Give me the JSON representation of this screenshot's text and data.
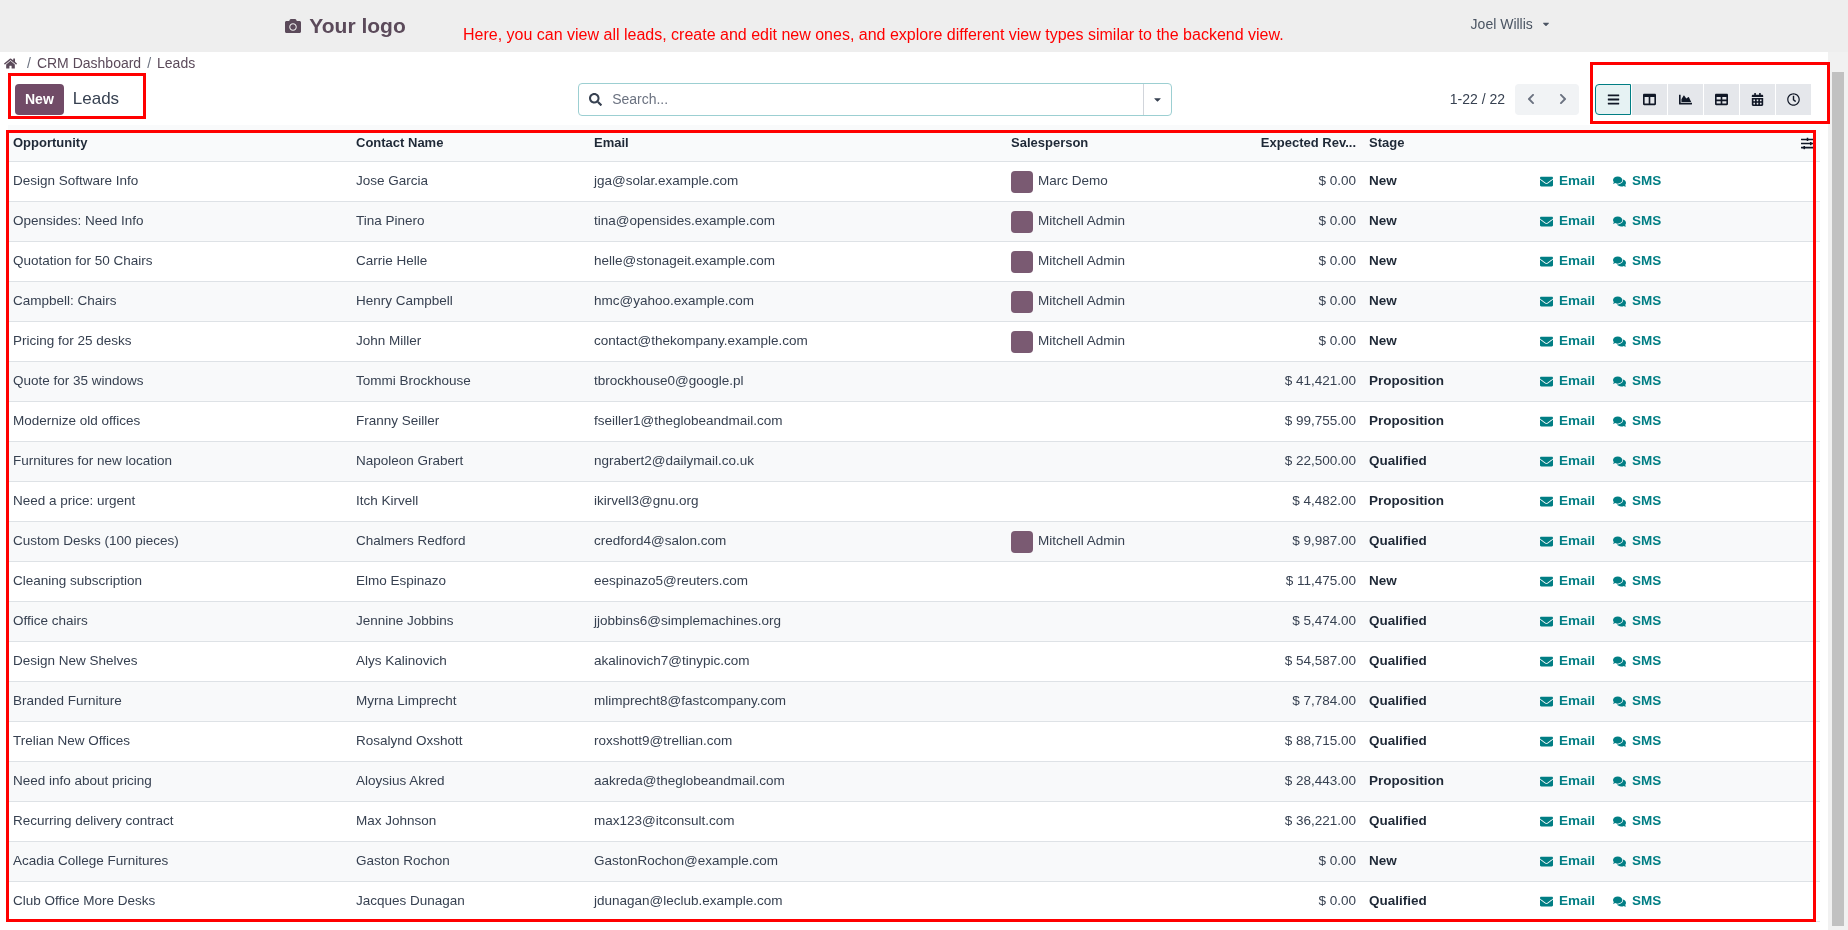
{
  "header": {
    "logo": "Your logo",
    "note": "Here, you can view all leads, create and edit new ones, and explore different view types similar to the backend view.",
    "user": "Joel Willis"
  },
  "breadcrumb": [
    {
      "kind": "separator",
      "text": "/"
    },
    {
      "kind": "link",
      "text": "CRM Dashboard"
    },
    {
      "kind": "separator",
      "text": "/"
    },
    {
      "kind": "link",
      "text": "Leads"
    }
  ],
  "control_panel": {
    "new_button": "New",
    "title": "Leads",
    "search": {
      "placeholder": "Search..."
    },
    "pager": "1-22 / 22",
    "views": [
      {
        "kind": "list",
        "selected": true
      },
      {
        "kind": "kanban",
        "selected": false
      },
      {
        "kind": "graph",
        "selected": false
      },
      {
        "kind": "pivot",
        "selected": false
      },
      {
        "kind": "calendar",
        "selected": false
      },
      {
        "kind": "activity",
        "selected": false
      }
    ]
  },
  "table": {
    "columns": [
      "Opportunity",
      "Contact Name",
      "Email",
      "Salesperson",
      "Expected Rev...",
      "Stage"
    ],
    "rows": [
      {
        "opportunity": "Design Software Info",
        "contact": "Jose Garcia",
        "email": "jga@solar.example.com",
        "salesperson": "Marc Demo",
        "revenue": "$ 0.00",
        "stage": "New",
        "email_action": "Email",
        "sms_action": "SMS"
      },
      {
        "opportunity": "Opensides: Need Info",
        "contact": "Tina Pinero",
        "email": "tina@opensides.example.com",
        "salesperson": "Mitchell Admin",
        "revenue": "$ 0.00",
        "stage": "New",
        "email_action": "Email",
        "sms_action": "SMS"
      },
      {
        "opportunity": "Quotation for 50 Chairs",
        "contact": "Carrie Helle",
        "email": "helle@stonageit.example.com",
        "salesperson": "Mitchell Admin",
        "revenue": "$ 0.00",
        "stage": "New",
        "email_action": "Email",
        "sms_action": "SMS"
      },
      {
        "opportunity": "Campbell: Chairs",
        "contact": "Henry Campbell",
        "email": "hmc@yahoo.example.com",
        "salesperson": "Mitchell Admin",
        "revenue": "$ 0.00",
        "stage": "New",
        "email_action": "Email",
        "sms_action": "SMS"
      },
      {
        "opportunity": "Pricing for 25 desks",
        "contact": "John Miller",
        "email": "contact@thekompany.example.com",
        "salesperson": "Mitchell Admin",
        "revenue": "$ 0.00",
        "stage": "New",
        "email_action": "Email",
        "sms_action": "SMS"
      },
      {
        "opportunity": "Quote for 35 windows",
        "contact": "Tommi Brockhouse",
        "email": "tbrockhouse0@google.pl",
        "revenue": "$ 41,421.00",
        "stage": "Proposition",
        "email_action": "Email",
        "sms_action": "SMS"
      },
      {
        "opportunity": "Modernize old offices",
        "contact": "Franny Seiller",
        "email": "fseiller1@theglobeandmail.com",
        "revenue": "$ 99,755.00",
        "stage": "Proposition",
        "email_action": "Email",
        "sms_action": "SMS"
      },
      {
        "opportunity": "Furnitures for new location",
        "contact": "Napoleon Grabert",
        "email": "ngrabert2@dailymail.co.uk",
        "revenue": "$ 22,500.00",
        "stage": "Qualified",
        "email_action": "Email",
        "sms_action": "SMS"
      },
      {
        "opportunity": "Need a price: urgent",
        "contact": "Itch Kirvell",
        "email": "ikirvell3@gnu.org",
        "revenue": "$ 4,482.00",
        "stage": "Proposition",
        "email_action": "Email",
        "sms_action": "SMS"
      },
      {
        "opportunity": "Custom Desks (100 pieces)",
        "contact": "Chalmers Redford",
        "email": "credford4@salon.com",
        "salesperson": "Mitchell Admin",
        "revenue": "$ 9,987.00",
        "stage": "Qualified",
        "email_action": "Email",
        "sms_action": "SMS"
      },
      {
        "opportunity": "Cleaning subscription",
        "contact": "Elmo Espinazo",
        "email": "eespinazo5@reuters.com",
        "revenue": "$ 11,475.00",
        "stage": "New",
        "email_action": "Email",
        "sms_action": "SMS"
      },
      {
        "opportunity": "Office chairs",
        "contact": "Jennine Jobbins",
        "email": "jjobbins6@simplemachines.org",
        "revenue": "$ 5,474.00",
        "stage": "Qualified",
        "email_action": "Email",
        "sms_action": "SMS"
      },
      {
        "opportunity": "Design New Shelves",
        "contact": "Alys Kalinovich",
        "email": "akalinovich7@tinypic.com",
        "revenue": "$ 54,587.00",
        "stage": "Qualified",
        "email_action": "Email",
        "sms_action": "SMS"
      },
      {
        "opportunity": "Branded Furniture",
        "contact": "Myrna Limprecht",
        "email": "mlimprecht8@fastcompany.com",
        "revenue": "$ 7,784.00",
        "stage": "Qualified",
        "email_action": "Email",
        "sms_action": "SMS"
      },
      {
        "opportunity": "Trelian New Offices",
        "contact": "Rosalynd Oxshott",
        "email": "roxshott9@trellian.com",
        "revenue": "$ 88,715.00",
        "stage": "Qualified",
        "email_action": "Email",
        "sms_action": "SMS"
      },
      {
        "opportunity": "Need info about pricing",
        "contact": "Aloysius Akred",
        "email": "aakreda@theglobeandmail.com",
        "revenue": "$ 28,443.00",
        "stage": "Proposition",
        "email_action": "Email",
        "sms_action": "SMS"
      },
      {
        "opportunity": "Recurring delivery contract",
        "contact": "Max Johnson",
        "email": "max123@itconsult.com",
        "revenue": "$ 36,221.00",
        "stage": "Qualified",
        "email_action": "Email",
        "sms_action": "SMS"
      },
      {
        "opportunity": "Acadia College Furnitures",
        "contact": "Gaston Rochon",
        "email": "GastonRochon@example.com",
        "revenue": "$ 0.00",
        "stage": "New",
        "email_action": "Email",
        "sms_action": "SMS"
      },
      {
        "opportunity": "Club Office More Desks",
        "contact": "Jacques Dunagan",
        "email": "jdunagan@leclub.example.com",
        "revenue": "$ 0.00",
        "stage": "Qualified",
        "email_action": "Email",
        "sms_action": "SMS"
      }
    ]
  }
}
